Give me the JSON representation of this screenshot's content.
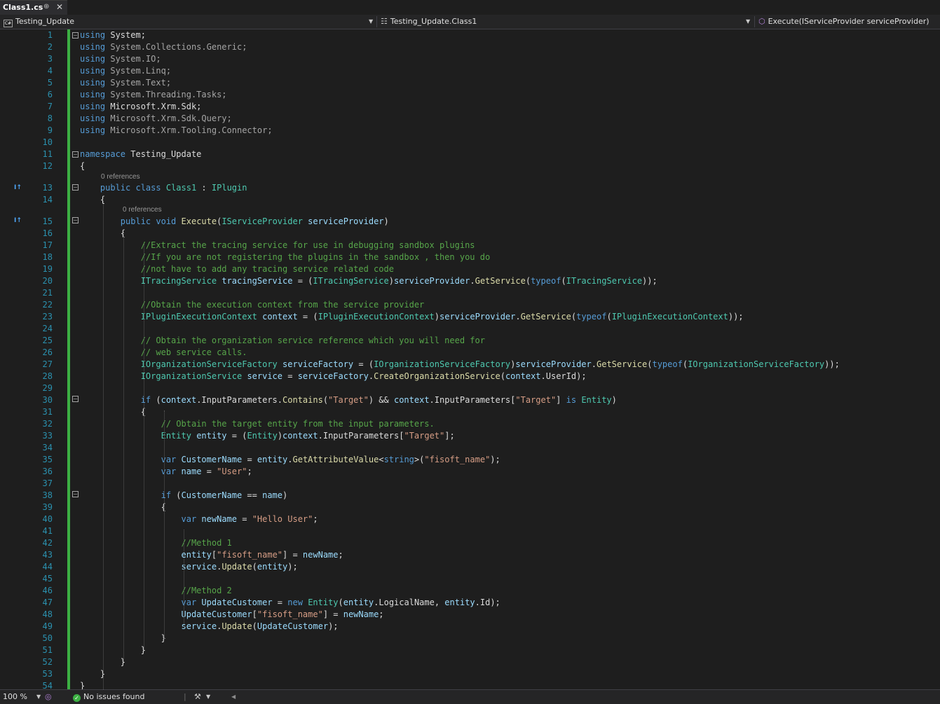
{
  "tab": {
    "title": "Class1.cs"
  },
  "nav": {
    "project": "Testing_Update",
    "class": "Testing_Update.Class1",
    "member": "Execute(IServiceProvider serviceProvider)"
  },
  "code_lines": [
    {
      "n": "1",
      "t": [
        [
          "kw",
          "using"
        ],
        [
          "",
          " "
        ],
        [
          "",
          "System;"
        ]
      ]
    },
    {
      "n": "2",
      "t": [
        [
          "kw",
          "using"
        ],
        [
          "ns",
          " System.Collections.Generic;"
        ]
      ]
    },
    {
      "n": "3",
      "t": [
        [
          "kw",
          "using"
        ],
        [
          "ns",
          " System.IO;"
        ]
      ]
    },
    {
      "n": "4",
      "t": [
        [
          "kw",
          "using"
        ],
        [
          "ns",
          " System.Linq;"
        ]
      ]
    },
    {
      "n": "5",
      "t": [
        [
          "kw",
          "using"
        ],
        [
          "ns",
          " System.Text;"
        ]
      ]
    },
    {
      "n": "6",
      "t": [
        [
          "kw",
          "using"
        ],
        [
          "ns",
          " System.Threading.Tasks;"
        ]
      ]
    },
    {
      "n": "7",
      "t": [
        [
          "kw",
          "using"
        ],
        [
          "",
          " Microsoft.Xrm.Sdk;"
        ]
      ]
    },
    {
      "n": "8",
      "t": [
        [
          "kw",
          "using"
        ],
        [
          "ns",
          " Microsoft.Xrm.Sdk.Query;"
        ]
      ]
    },
    {
      "n": "9",
      "t": [
        [
          "kw",
          "using"
        ],
        [
          "ns",
          " Microsoft.Xrm.Tooling.Connector;"
        ]
      ]
    },
    {
      "n": "10",
      "t": []
    },
    {
      "n": "11",
      "t": [
        [
          "kw",
          "namespace"
        ],
        [
          "",
          " Testing_Update"
        ]
      ]
    },
    {
      "n": "12",
      "t": [
        [
          "",
          "{"
        ]
      ]
    },
    {
      "n": "13",
      "t": [
        [
          "",
          "    "
        ],
        [
          "kw",
          "public class"
        ],
        [
          "",
          " "
        ],
        [
          "ty",
          "Class1"
        ],
        [
          "",
          " : "
        ],
        [
          "ty",
          "IPlugin"
        ]
      ]
    },
    {
      "n": "14",
      "t": [
        [
          "",
          "    {"
        ]
      ]
    },
    {
      "n": "15",
      "t": [
        [
          "",
          "        "
        ],
        [
          "kw",
          "public void"
        ],
        [
          "",
          " "
        ],
        [
          "mt",
          "Execute"
        ],
        [
          "",
          "("
        ],
        [
          "ty",
          "IServiceProvider"
        ],
        [
          "",
          " "
        ],
        [
          "vr",
          "serviceProvider"
        ],
        [
          "",
          ")"
        ]
      ]
    },
    {
      "n": "16",
      "t": [
        [
          "",
          "        {"
        ]
      ]
    },
    {
      "n": "17",
      "t": [
        [
          "",
          "            "
        ],
        [
          "cm",
          "//Extract the tracing service for use in debugging sandbox plugins"
        ]
      ]
    },
    {
      "n": "18",
      "t": [
        [
          "",
          "            "
        ],
        [
          "cm",
          "//If you are not registering the plugins in the sandbox , then you do"
        ]
      ]
    },
    {
      "n": "19",
      "t": [
        [
          "",
          "            "
        ],
        [
          "cm",
          "//not have to add any tracing service related code"
        ]
      ]
    },
    {
      "n": "20",
      "t": [
        [
          "",
          "            "
        ],
        [
          "ty",
          "ITracingService"
        ],
        [
          "",
          " "
        ],
        [
          "vr",
          "tracingService"
        ],
        [
          "",
          " = ("
        ],
        [
          "ty",
          "ITracingService"
        ],
        [
          "",
          ")"
        ],
        [
          "vr",
          "serviceProvider"
        ],
        [
          "",
          "."
        ],
        [
          "mt",
          "GetService"
        ],
        [
          "",
          "("
        ],
        [
          "kw",
          "typeof"
        ],
        [
          "",
          "("
        ],
        [
          "ty",
          "ITracingService"
        ],
        [
          "",
          "));"
        ]
      ]
    },
    {
      "n": "21",
      "t": []
    },
    {
      "n": "22",
      "t": [
        [
          "",
          "            "
        ],
        [
          "cm",
          "//Obtain the execution context from the service provider"
        ]
      ]
    },
    {
      "n": "23",
      "t": [
        [
          "",
          "            "
        ],
        [
          "ty",
          "IPluginExecutionContext"
        ],
        [
          "",
          " "
        ],
        [
          "vr",
          "context"
        ],
        [
          "",
          " = ("
        ],
        [
          "ty",
          "IPluginExecutionContext"
        ],
        [
          "",
          ")"
        ],
        [
          "vr",
          "serviceProvider"
        ],
        [
          "",
          "."
        ],
        [
          "mt",
          "GetService"
        ],
        [
          "",
          "("
        ],
        [
          "kw",
          "typeof"
        ],
        [
          "",
          "("
        ],
        [
          "ty",
          "IPluginExecutionContext"
        ],
        [
          "",
          "));"
        ]
      ]
    },
    {
      "n": "24",
      "t": []
    },
    {
      "n": "25",
      "t": [
        [
          "",
          "            "
        ],
        [
          "cm",
          "// Obtain the organization service reference which you will need for"
        ]
      ]
    },
    {
      "n": "26",
      "t": [
        [
          "",
          "            "
        ],
        [
          "cm",
          "// web service calls."
        ]
      ]
    },
    {
      "n": "27",
      "t": [
        [
          "",
          "            "
        ],
        [
          "ty",
          "IOrganizationServiceFactory"
        ],
        [
          "",
          " "
        ],
        [
          "vr",
          "serviceFactory"
        ],
        [
          "",
          " = ("
        ],
        [
          "ty",
          "IOrganizationServiceFactory"
        ],
        [
          "",
          ")"
        ],
        [
          "vr",
          "serviceProvider"
        ],
        [
          "",
          "."
        ],
        [
          "mt",
          "GetService"
        ],
        [
          "",
          "("
        ],
        [
          "kw",
          "typeof"
        ],
        [
          "",
          "("
        ],
        [
          "ty",
          "IOrganizationServiceFactory"
        ],
        [
          "",
          "));"
        ]
      ]
    },
    {
      "n": "28",
      "t": [
        [
          "",
          "            "
        ],
        [
          "ty",
          "IOrganizationService"
        ],
        [
          "",
          " "
        ],
        [
          "vr",
          "service"
        ],
        [
          "",
          " = "
        ],
        [
          "vr",
          "serviceFactory"
        ],
        [
          "",
          "."
        ],
        [
          "mt",
          "CreateOrganizationService"
        ],
        [
          "",
          "("
        ],
        [
          "vr",
          "context"
        ],
        [
          "",
          ".UserId);"
        ]
      ]
    },
    {
      "n": "29",
      "t": []
    },
    {
      "n": "30",
      "t": [
        [
          "",
          "            "
        ],
        [
          "kw",
          "if"
        ],
        [
          "",
          " ("
        ],
        [
          "vr",
          "context"
        ],
        [
          "",
          ".InputParameters."
        ],
        [
          "mt",
          "Contains"
        ],
        [
          "",
          "("
        ],
        [
          "st",
          "\"Target\""
        ],
        [
          "",
          ") && "
        ],
        [
          "vr",
          "context"
        ],
        [
          "",
          ".InputParameters["
        ],
        [
          "st",
          "\"Target\""
        ],
        [
          "",
          "] "
        ],
        [
          "kw",
          "is"
        ],
        [
          "",
          " "
        ],
        [
          "ty",
          "Entity"
        ],
        [
          "",
          ")"
        ]
      ]
    },
    {
      "n": "31",
      "t": [
        [
          "",
          "            {"
        ]
      ]
    },
    {
      "n": "32",
      "t": [
        [
          "",
          "                "
        ],
        [
          "cm",
          "// Obtain the target entity from the input parameters."
        ]
      ]
    },
    {
      "n": "33",
      "t": [
        [
          "",
          "                "
        ],
        [
          "ty",
          "Entity"
        ],
        [
          "",
          " "
        ],
        [
          "vr",
          "entity"
        ],
        [
          "",
          " = ("
        ],
        [
          "ty",
          "Entity"
        ],
        [
          "",
          ")"
        ],
        [
          "vr",
          "context"
        ],
        [
          "",
          ".InputParameters["
        ],
        [
          "st",
          "\"Target\""
        ],
        [
          "",
          "];"
        ]
      ]
    },
    {
      "n": "34",
      "t": []
    },
    {
      "n": "35",
      "t": [
        [
          "",
          "                "
        ],
        [
          "kw",
          "var"
        ],
        [
          "",
          " "
        ],
        [
          "vr",
          "CustomerName"
        ],
        [
          "",
          " = "
        ],
        [
          "vr",
          "entity"
        ],
        [
          "",
          "."
        ],
        [
          "mt",
          "GetAttributeValue"
        ],
        [
          "",
          "<"
        ],
        [
          "kw",
          "string"
        ],
        [
          "",
          ">("
        ],
        [
          "st",
          "\"fisoft_name\""
        ],
        [
          "",
          ");"
        ]
      ]
    },
    {
      "n": "36",
      "t": [
        [
          "",
          "                "
        ],
        [
          "kw",
          "var"
        ],
        [
          "",
          " "
        ],
        [
          "vr",
          "name"
        ],
        [
          "",
          " = "
        ],
        [
          "st",
          "\"User\""
        ],
        [
          "",
          ";"
        ]
      ]
    },
    {
      "n": "37",
      "t": []
    },
    {
      "n": "38",
      "t": [
        [
          "",
          "                "
        ],
        [
          "kw",
          "if"
        ],
        [
          "",
          " ("
        ],
        [
          "vr",
          "CustomerName"
        ],
        [
          "",
          " == "
        ],
        [
          "vr",
          "name"
        ],
        [
          "",
          ")"
        ]
      ]
    },
    {
      "n": "39",
      "t": [
        [
          "",
          "                {"
        ]
      ]
    },
    {
      "n": "40",
      "t": [
        [
          "",
          "                    "
        ],
        [
          "kw",
          "var"
        ],
        [
          "",
          " "
        ],
        [
          "vr",
          "newName"
        ],
        [
          "",
          " = "
        ],
        [
          "st",
          "\"Hello User\""
        ],
        [
          "",
          ";"
        ]
      ]
    },
    {
      "n": "41",
      "t": []
    },
    {
      "n": "42",
      "t": [
        [
          "",
          "                    "
        ],
        [
          "cm",
          "//Method 1"
        ]
      ]
    },
    {
      "n": "43",
      "t": [
        [
          "",
          "                    "
        ],
        [
          "vr",
          "entity"
        ],
        [
          "",
          "["
        ],
        [
          "st",
          "\"fisoft_name\""
        ],
        [
          "",
          "] = "
        ],
        [
          "vr",
          "newName"
        ],
        [
          "",
          ";"
        ]
      ]
    },
    {
      "n": "44",
      "t": [
        [
          "",
          "                    "
        ],
        [
          "vr",
          "service"
        ],
        [
          "",
          "."
        ],
        [
          "mt",
          "Update"
        ],
        [
          "",
          "("
        ],
        [
          "vr",
          "entity"
        ],
        [
          "",
          ");"
        ]
      ]
    },
    {
      "n": "45",
      "t": []
    },
    {
      "n": "46",
      "t": [
        [
          "",
          "                    "
        ],
        [
          "cm",
          "//Method 2"
        ]
      ]
    },
    {
      "n": "47",
      "t": [
        [
          "",
          "                    "
        ],
        [
          "kw",
          "var"
        ],
        [
          "",
          " "
        ],
        [
          "vr",
          "UpdateCustomer"
        ],
        [
          "",
          " = "
        ],
        [
          "kw",
          "new"
        ],
        [
          "",
          " "
        ],
        [
          "ty",
          "Entity"
        ],
        [
          "",
          "("
        ],
        [
          "vr",
          "entity"
        ],
        [
          "",
          ".LogicalName, "
        ],
        [
          "vr",
          "entity"
        ],
        [
          "",
          ".Id);"
        ]
      ]
    },
    {
      "n": "48",
      "t": [
        [
          "",
          "                    "
        ],
        [
          "vr",
          "UpdateCustomer"
        ],
        [
          "",
          "["
        ],
        [
          "st",
          "\"fisoft_name\""
        ],
        [
          "",
          "] = "
        ],
        [
          "vr",
          "newName"
        ],
        [
          "",
          ";"
        ]
      ]
    },
    {
      "n": "49",
      "t": [
        [
          "",
          "                    "
        ],
        [
          "vr",
          "service"
        ],
        [
          "",
          "."
        ],
        [
          "mt",
          "Update"
        ],
        [
          "",
          "("
        ],
        [
          "vr",
          "UpdateCustomer"
        ],
        [
          "",
          ");"
        ]
      ]
    },
    {
      "n": "50",
      "t": [
        [
          "",
          "                }"
        ]
      ]
    },
    {
      "n": "51",
      "t": [
        [
          "",
          "            }"
        ]
      ]
    },
    {
      "n": "52",
      "t": [
        [
          "",
          "        }"
        ]
      ]
    },
    {
      "n": "53",
      "t": [
        [
          "",
          "    }"
        ]
      ]
    },
    {
      "n": "54",
      "t": [
        [
          "",
          "}"
        ]
      ]
    }
  ],
  "references": {
    "class": "0 references",
    "method": "0 references"
  },
  "status": {
    "zoom": "100 %",
    "issues": "No issues found"
  },
  "colors": {
    "keyword": "#569cd6",
    "type": "#4ec9b0",
    "string": "#d69d85",
    "comment": "#57a64a",
    "method": "#dcdcaa",
    "variable": "#9cdcfe",
    "line_number": "#2b91af",
    "change_bar": "#3cb043"
  }
}
